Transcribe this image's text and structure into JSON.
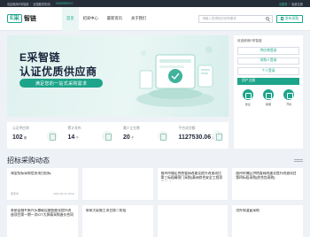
{
  "topbar": {
    "welcome": "欢迎使用E采智链",
    "service_label": "全国服务热线：",
    "phone": "13602959474",
    "login": "请登录",
    "register": "免费注册"
  },
  "brand": {
    "logo_mark": "E采",
    "logo_text": "智链"
  },
  "nav": [
    {
      "label": "首页",
      "active": true
    },
    {
      "label": "招采中心",
      "active": false
    },
    {
      "label": "最新资讯",
      "active": false
    },
    {
      "label": "关于我们",
      "active": false
    }
  ],
  "search": {
    "placeholder": "请输入您想找的采购需求"
  },
  "publish_button": "发布采购",
  "hero": {
    "title1": "E采智链",
    "title2": "认证优质供应商",
    "tag": "满足您的一站式采购需求"
  },
  "stats": [
    {
      "label": "认证供应商",
      "value": "102",
      "unit": "家"
    },
    {
      "label": "累计发布",
      "value": "14",
      "unit": "个"
    },
    {
      "label": "最少企业数",
      "value": "20",
      "unit": "个"
    },
    {
      "label": "平台成交额",
      "value": "1127530.06",
      "unit": "元"
    }
  ],
  "sidebar": {
    "welcome": "欢迎使用E采智链",
    "buttons": [
      "供应商登录",
      "采购人登录",
      "个人登录",
      "用户注册"
    ],
    "icons": [
      {
        "label": "建议",
        "icon": "suggestion-icon"
      },
      {
        "label": "客服",
        "icon": "service-icon"
      },
      {
        "label": "开标",
        "icon": "bid-icon"
      }
    ]
  },
  "section": {
    "title": "招标采购动态"
  },
  "cards": [
    {
      "title": "淘宝招标采购信息项目招标",
      "tag": "",
      "tag2": "",
      "meta_left": "西安市",
      "meta_right": "2023-02-13 10:00"
    },
    {
      "title": "",
      "tag": "",
      "tag2": "",
      "meta_left": "",
      "meta_right": ""
    },
    {
      "title": "眉州市城区供热管网改建及提升改造项目第三标段精密门采购(满洲综合安全工程项目部(全))",
      "tag": "",
      "tag2": "",
      "meta_left": "",
      "meta_right": ""
    },
    {
      "title": "眉州市城区供热管网改建及提升改造项目第四标段采购(综合包采购)",
      "tag": "",
      "tag2": "",
      "meta_left": "",
      "meta_right": ""
    },
    {
      "title": "蒂昂县城乡新兴乐基础设施智能化提升改造项目第一期一次IOT大屏幕采购造价合同",
      "tag": "",
      "tag2": "",
      "meta_left": "",
      "meta_right": ""
    },
    {
      "title": "蒂昂大厦施工项目第二阶段",
      "tag": "",
      "tag2": "",
      "meta_left": "",
      "meta_right": ""
    },
    {
      "title": "",
      "tag": "",
      "tag2": "",
      "meta_left": "",
      "meta_right": ""
    },
    {
      "title": "功外保温窗采购",
      "tag": "",
      "tag2": "",
      "meta_left": "",
      "meta_right": ""
    }
  ]
}
